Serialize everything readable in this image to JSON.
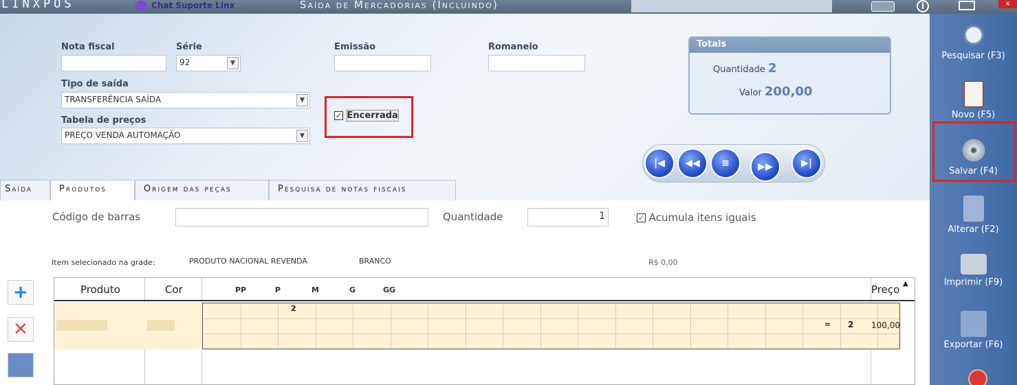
{
  "titlebar": {
    "logo": "LINXPOS",
    "chat_label": "Chat Suporte Linx",
    "window_title": "Saída de Mercadorias (Incluindo)",
    "close_label": "x"
  },
  "form": {
    "nota_fiscal_label": "Nota fiscal",
    "nota_fiscal_value": "",
    "serie_label": "Série",
    "serie_value": "92",
    "emissao_label": "Emissão",
    "emissao_value": "",
    "romaneio_label": "Romaneio",
    "romaneio_value": "",
    "tipo_saida_label": "Tipo de saída",
    "tipo_saida_value": "TRANSFERÊNCIA SAÍDA",
    "tabela_precos_label": "Tabela de preços",
    "tabela_precos_value": "PREÇO VENDA AUTOMAÇÃO",
    "encerrada_label": "Encerrada"
  },
  "totais": {
    "title": "Totais",
    "quantidade_label": "Quantidade",
    "quantidade_value": "2",
    "valor_label": "Valor",
    "valor_value": "200,00"
  },
  "tabs": [
    {
      "label": "Saída"
    },
    {
      "label": "Produtos"
    },
    {
      "label": "Origem das peças"
    },
    {
      "label": "Pesquisa de notas fiscais"
    }
  ],
  "produtos": {
    "codigo_barras_label": "Código de barras",
    "quantidade_label": "Quantidade",
    "quantidade_value": "1",
    "acumula_label": "Acumula itens iguais",
    "item_selecionado_label": "Item selecionado na grade:",
    "item_produto": "PRODUTO NACIONAL REVENDA",
    "item_cor": "BRANCO",
    "item_preco": "R$ 0,00"
  },
  "grid": {
    "headers": {
      "produto": "Produto",
      "cor": "Cor",
      "preco": "Preço"
    },
    "sizes": [
      "PP",
      "P",
      "M",
      "G",
      "GG"
    ],
    "row": {
      "p_qty": "2",
      "eq": "=",
      "total": "2",
      "preco": "100,00"
    }
  },
  "toolbar": [
    {
      "label": "Pesquisar (F3)",
      "icon": "search-icon"
    },
    {
      "label": "Novo (F5)",
      "icon": "new-document-icon"
    },
    {
      "label": "Salvar (F4)",
      "icon": "disk-save-icon"
    },
    {
      "label": "Alterar (F2)",
      "icon": "edit-icon"
    },
    {
      "label": "Imprimir (F9)",
      "icon": "printer-icon"
    },
    {
      "label": "Exportar (F6)",
      "icon": "export-icon"
    }
  ]
}
